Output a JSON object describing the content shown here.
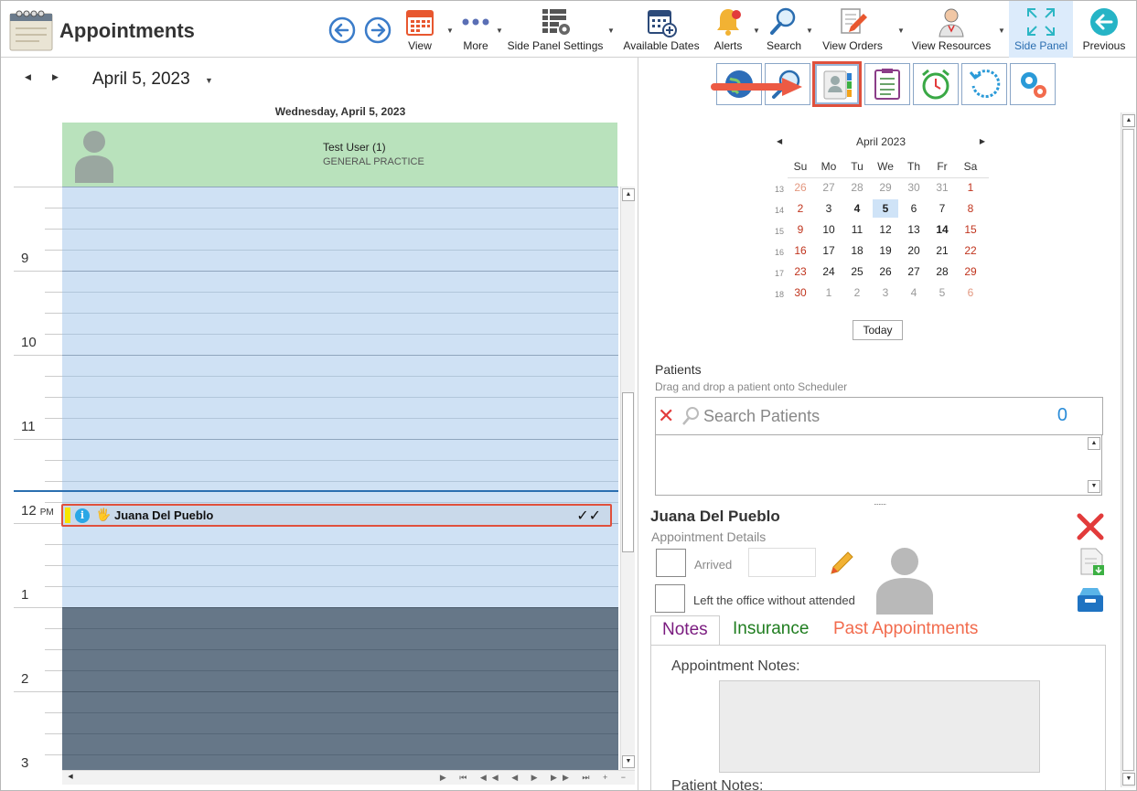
{
  "app": {
    "title": "Appointments"
  },
  "toolbar": {
    "view": "View",
    "more": "More",
    "side_panel_settings": "Side Panel Settings",
    "available_dates": "Available Dates",
    "alerts": "Alerts",
    "search": "Search",
    "view_orders": "View Orders",
    "view_resources": "View Resources",
    "side_panel": "Side Panel",
    "previous": "Previous"
  },
  "scheduler": {
    "date_title": "April 5, 2023",
    "day_header": "Wednesday, April 5, 2023",
    "resource_name": "Test User (1)",
    "resource_dept": "GENERAL PRACTICE",
    "hours": [
      {
        "label": "9",
        "suffix": ""
      },
      {
        "label": "10",
        "suffix": ""
      },
      {
        "label": "11",
        "suffix": ""
      },
      {
        "label": "12",
        "suffix": "PM"
      },
      {
        "label": "1",
        "suffix": ""
      },
      {
        "label": "2",
        "suffix": ""
      },
      {
        "label": "3",
        "suffix": ""
      }
    ],
    "appointment": {
      "patient": "Juana Del Pueblo",
      "info": "i",
      "status": "✓✓"
    }
  },
  "calendar": {
    "month": "April 2023",
    "weekdays": [
      "Su",
      "Mo",
      "Tu",
      "We",
      "Th",
      "Fr",
      "Sa"
    ],
    "weeks": [
      {
        "wk": "13",
        "days": [
          "26",
          "27",
          "28",
          "29",
          "30",
          "31",
          "1"
        ]
      },
      {
        "wk": "14",
        "days": [
          "2",
          "3",
          "4",
          "5",
          "6",
          "7",
          "8"
        ]
      },
      {
        "wk": "15",
        "days": [
          "9",
          "10",
          "11",
          "12",
          "13",
          "14",
          "15"
        ]
      },
      {
        "wk": "16",
        "days": [
          "16",
          "17",
          "18",
          "19",
          "20",
          "21",
          "22"
        ]
      },
      {
        "wk": "17",
        "days": [
          "23",
          "24",
          "25",
          "26",
          "27",
          "28",
          "29"
        ]
      },
      {
        "wk": "18",
        "days": [
          "30",
          "1",
          "2",
          "3",
          "4",
          "5",
          "6"
        ]
      }
    ],
    "selected_day": "5",
    "today": "Today"
  },
  "patients": {
    "title": "Patients",
    "hint": "Drag and drop a patient onto Scheduler",
    "search_placeholder": "Search Patients",
    "count": "0"
  },
  "details": {
    "name": "Juana Del Pueblo",
    "subtitle": "Appointment Details",
    "arrived": "Arrived",
    "left_office": "Left the office without attended",
    "tabs": {
      "notes": "Notes",
      "insurance": "Insurance",
      "past": "Past Appointments"
    },
    "appointment_notes": "Appointment Notes:",
    "patient_notes": "Patient Notes:"
  },
  "colors": {
    "accent": "#e0503c",
    "selected_tab_bg": "#dcebfb",
    "resource_bg": "#b9e2bc"
  }
}
